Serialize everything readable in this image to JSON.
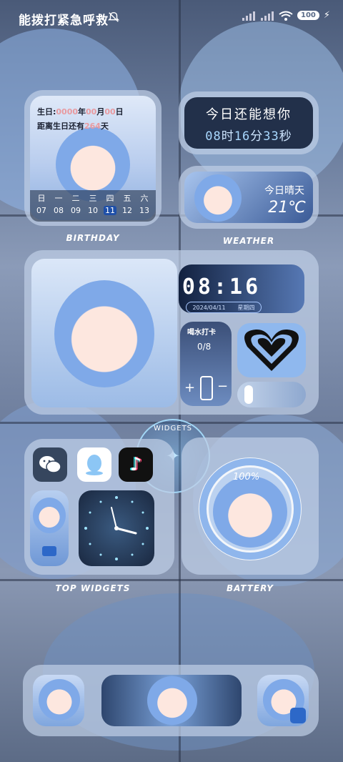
{
  "status_bar": {
    "carrier_text": "能拨打紧急呼救",
    "battery_level": "100",
    "icons": [
      "mute-bell-icon",
      "signal-icon",
      "signal-icon",
      "wifi-icon",
      "battery-icon",
      "charging-icon"
    ]
  },
  "birthday": {
    "line1_prefix": "生日:",
    "year": "0000",
    "year_label": "年",
    "month": "00",
    "month_label": "月",
    "day": "00",
    "day_label": "日",
    "line2_prefix": "距离生日还有",
    "days_left": "264",
    "days_unit": "天",
    "weekdays": [
      "日",
      "一",
      "二",
      "三",
      "四",
      "五",
      "六"
    ],
    "dates": [
      "07",
      "08",
      "09",
      "10",
      "11",
      "12",
      "13"
    ],
    "today_index": 4,
    "caption": "BIRTHDAY"
  },
  "time_text": {
    "line1": "今日还能想你",
    "hour": "08",
    "hour_unit": "时",
    "minute": "16",
    "minute_unit": "分",
    "second": "33",
    "second_unit": "秒"
  },
  "weather": {
    "condition": "今日晴天",
    "temperature": "21℃",
    "caption": "WEATHER"
  },
  "clock_widget": {
    "digits": "08:16",
    "date": "2024/04/11",
    "weekday": "星期四"
  },
  "water": {
    "title": "喝水打卡",
    "count": "0/8"
  },
  "widgets_label": "WIDGETS",
  "apps": {
    "items": [
      "wechat-app",
      "qq-app",
      "tiktok-app",
      "camera-app",
      "clock-app"
    ],
    "caption": "TOP WIDGETS"
  },
  "battery": {
    "percent": "100%",
    "level": 1.0,
    "caption": "BATTERY"
  },
  "colors": {
    "accent": "#2d68c8",
    "frame": "#bfcde4",
    "highlight": "#e89aa0"
  }
}
